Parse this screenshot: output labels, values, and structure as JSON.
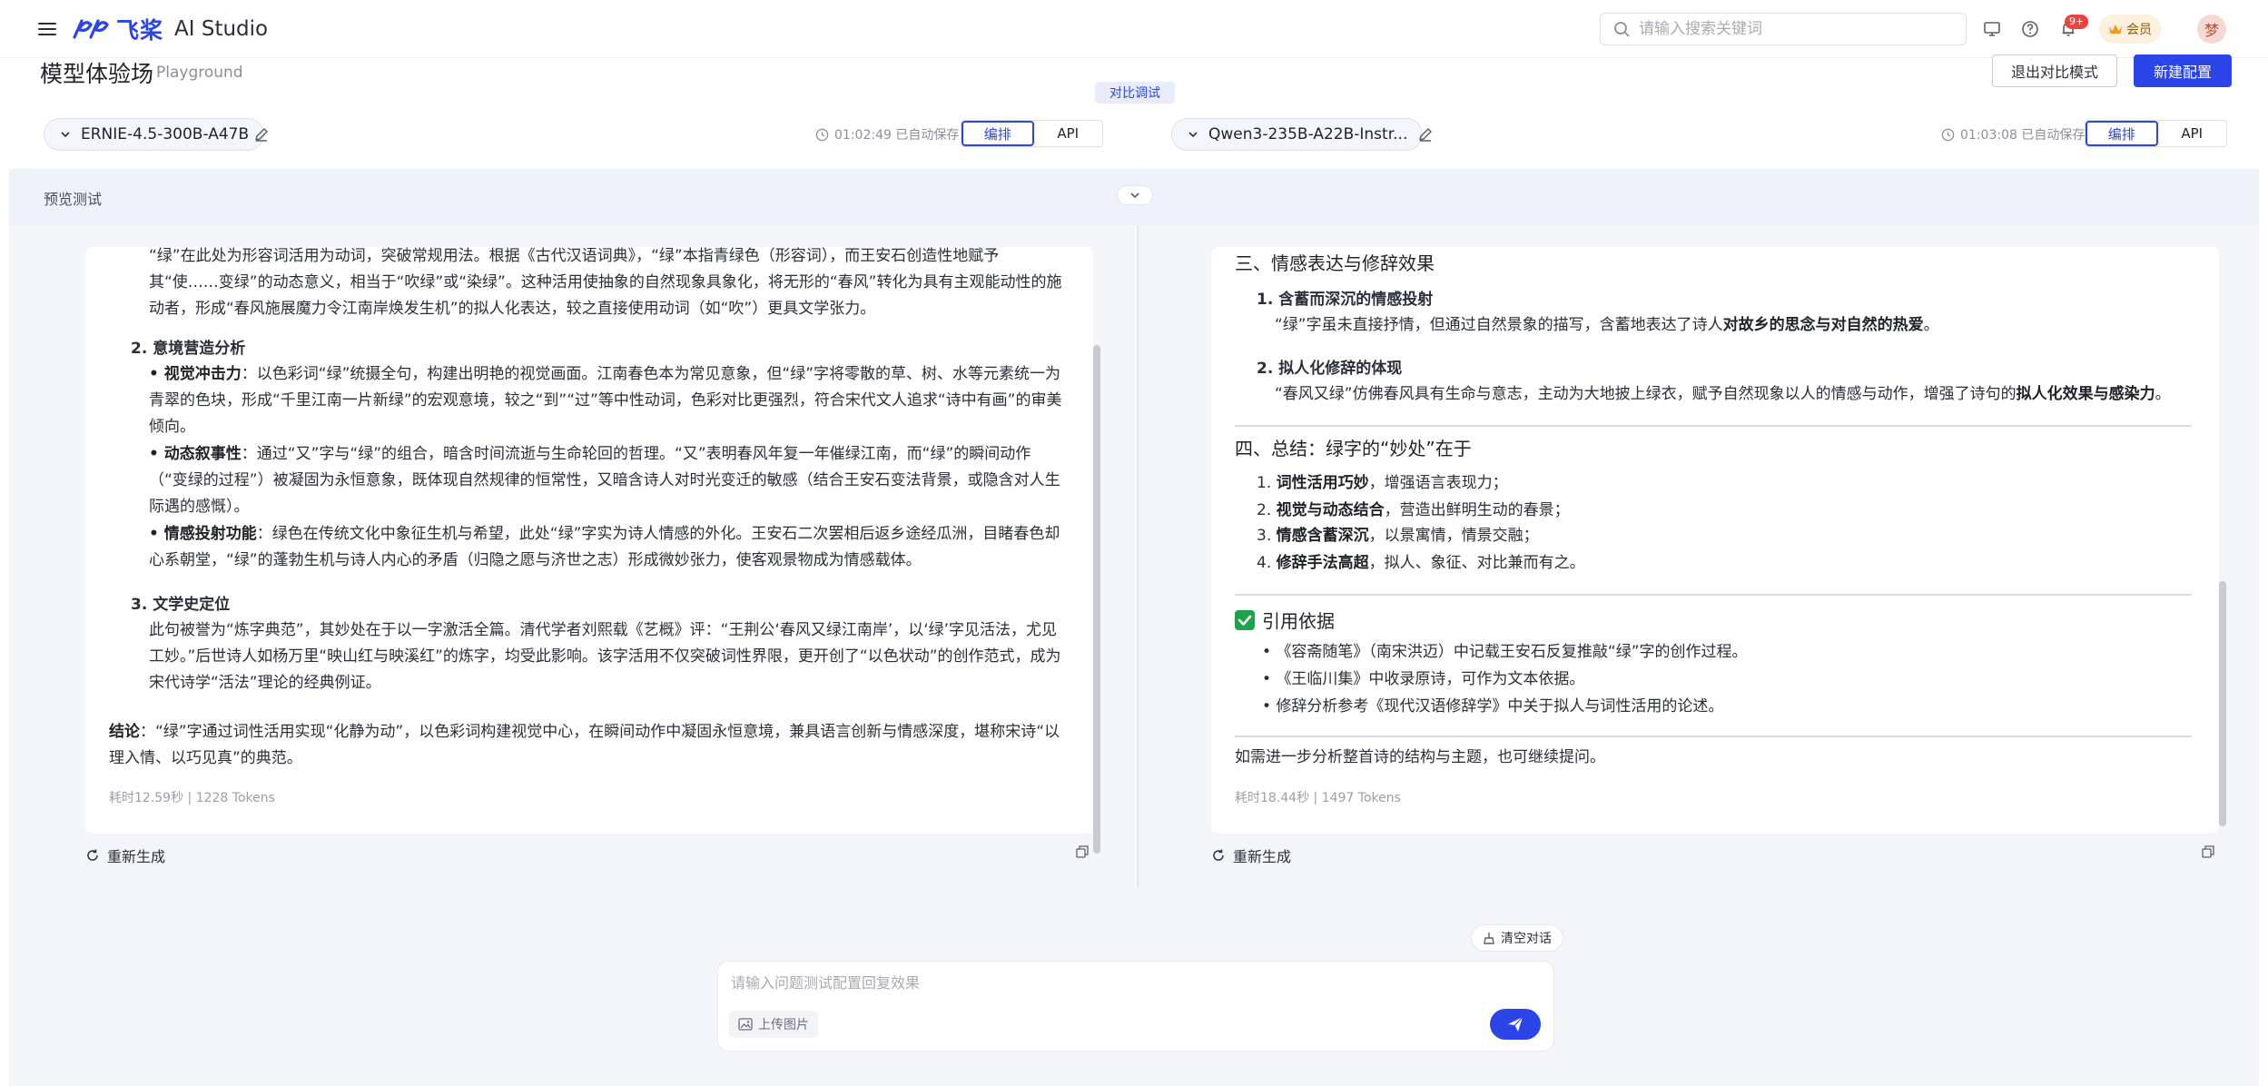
{
  "topbar": {
    "brand": "飞桨",
    "product": "AI Studio",
    "search_placeholder": "请输入搜索关键词",
    "notification_badge": "9+",
    "vip_label": "会员",
    "avatar_text": "梦"
  },
  "page": {
    "title": "模型体验场",
    "subtitle": "Playground",
    "exit_compare": "退出对比模式",
    "new_config": "新建配置",
    "compare_tag": "对比调试"
  },
  "left_model": {
    "name": "ERNIE-4.5-300B-A47B",
    "autosave": "01:02:49 已自动保存",
    "tab_arrange": "编排",
    "tab_api": "API"
  },
  "right_model": {
    "name": "Qwen3-235B-A22B-Instr...",
    "autosave": "01:03:08 已自动保存",
    "tab_arrange": "编排",
    "tab_api": "API"
  },
  "preview": {
    "title": "预览测试"
  },
  "left_answer": {
    "p1": "“绿”在此处为形容词活用为动词，突破常规用法。根据《古代汉语词典》，“绿”本指青绿色（形容词），而王安石创造性地赋予其“使……变绿”的动态意义，相当于“吹绿”或“染绿”。这种活用使抽象的自然现象具象化，将无形的“春风”转化为具有主观能动性的施动者，形成“春风施展魔力令江南岸焕发生机”的拟人化表达，较之直接使用动词（如“吹”）更具文学张力。",
    "s2_title": "2. 意境营造分析",
    "s2_b1_label": "• 视觉冲击力",
    "s2_b1": "：以色彩词“绿”统摄全句，构建出明艳的视觉画面。江南春色本为常见意象，但“绿”字将零散的草、树、水等元素统一为青翠的色块，形成“千里江南一片新绿”的宏观意境，较之“到”“过”等中性动词，色彩对比更强烈，符合宋代文人追求“诗中有画”的审美倾向。",
    "s2_b2_label": "• 动态叙事性",
    "s2_b2": "：通过“又”字与“绿”的组合，暗含时间流逝与生命轮回的哲理。“又”表明春风年复一年催绿江南，而“绿”的瞬间动作（“变绿的过程”）被凝固为永恒意象，既体现自然规律的恒常性，又暗含诗人对时光变迁的敏感（结合王安石变法背景，或隐含对人生际遇的感慨）。",
    "s2_b3_label": "• 情感投射功能",
    "s2_b3": "：绿色在传统文化中象征生机与希望，此处“绿”字实为诗人情感的外化。王安石二次罢相后返乡途经瓜洲，目睹春色却心系朝堂，“绿”的蓬勃生机与诗人内心的矛盾（归隐之愿与济世之志）形成微妙张力，使客观景物成为情感载体。",
    "s3_title": "3. 文学史定位",
    "s3": "此句被誉为“炼字典范”，其妙处在于以一字激活全篇。清代学者刘熙载《艺概》评：“王荆公‘春风又绿江南岸’，以‘绿’字见活法，尤见工妙。”后世诗人如杨万里“映山红与映溪红”的炼字，均受此影响。该字活用不仅突破词性界限，更开创了“以色状动”的创作范式，成为宋代诗学“活法”理论的经典例证。",
    "conclusion_label": "结论",
    "conclusion": "：“绿”字通过词性活用实现“化静为动”，以色彩词构建视觉中心，在瞬间动作中凝固永恒意境，兼具语言创新与情感深度，堪称宋诗“以理入情、以巧见真”的典范。",
    "meta": "耗时12.59秒 | 1228 Tokens",
    "regen": "重新生成"
  },
  "right_answer": {
    "h_three": "三、情感表达与修辞效果",
    "i1_title": "1. 含蓄而深沉的情感投射",
    "i1_pre": "“绿”字虽未直接抒情，但通过自然景象的描写，含蓄地表达了诗人",
    "i1_bold": "对故乡的思念与对自然的热爱",
    "i1_post": "。",
    "i2_title": "2. 拟人化修辞的体现",
    "i2_pre": "“春风又绿”仿佛春风具有生命与意志，主动为大地披上绿衣，赋予自然现象以人的情感与动作，增强了诗句的",
    "i2_bold": "拟人化效果与感染力",
    "i2_post": "。",
    "h_four": "四、总结：绿字的“妙处”在于",
    "s1_num": "1.",
    "s1_bold": "词性活用巧妙",
    "s1": "，增强语言表现力；",
    "s2_num": "2.",
    "s2_bold": "视觉与动态结合",
    "s2": "，营造出鲜明生动的春景；",
    "s3_num": "3.",
    "s3_bold": "情感含蓄深沉",
    "s3": "，以景寓情，情景交融；",
    "s4_num": "4.",
    "s4_bold": "修辞手法高超",
    "s4": "，拟人、象征、对比兼而有之。",
    "h_ref": "引用依据",
    "ref1": "《容斋随笔》（南宋洪迈）中记载王安石反复推敲“绿”字的创作过程。",
    "ref2": "《王临川集》中收录原诗，可作为文本依据。",
    "ref3": "修辞分析参考《现代汉语修辞学》中关于拟人与词性活用的论述。",
    "closing": "如需进一步分析整首诗的结构与主题，也可继续提问。",
    "meta": "耗时18.44秒 | 1497 Tokens",
    "regen": "重新生成"
  },
  "composer": {
    "clear": "清空对话",
    "placeholder": "请输入问题测试配置回复效果",
    "upload": "上传图片"
  },
  "colors": {
    "accent": "#2b45e8",
    "panel_bg": "#f3f5f9",
    "check_green": "#1fa34a"
  }
}
